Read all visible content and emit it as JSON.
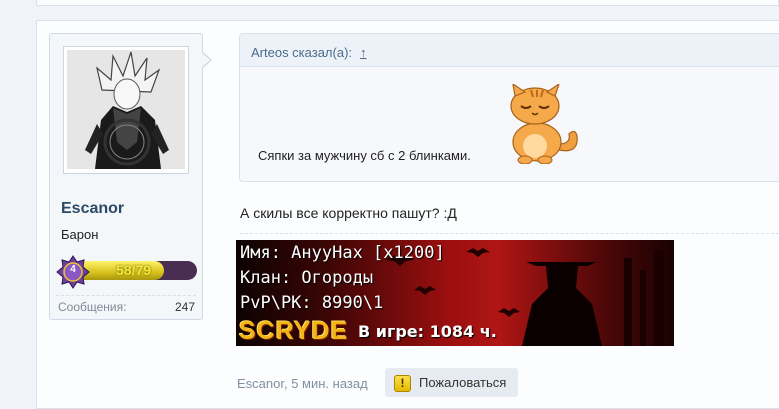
{
  "user": {
    "name": "Escanor",
    "title": "Барон",
    "level": "4",
    "xp_text": "58/79",
    "xp_fraction": 0.734,
    "messages_label": "Сообщения:",
    "messages_count": "247"
  },
  "quote": {
    "author": "Arteos сказал(а):",
    "link_glyph": "↑",
    "text": "Сяпки за мужчину сб с 2 блинками."
  },
  "post": {
    "text": "А скилы все корректно пашут? :Д"
  },
  "signature": {
    "name_line": "Имя: АнууНах [x1200]",
    "clan_line": "Клан: Огороды",
    "pvp_line": "PvP\\PK: 8990\\1",
    "logo": "SCRYDE",
    "ingame": "В игре: 1084 ч."
  },
  "meta": {
    "author_time": "Escanor, 5 мин. назад",
    "report_label": "Пожаловаться"
  },
  "colors": {
    "username": "#2b4a66",
    "link": "#4a6b8a",
    "xp_text": "#f2e93a",
    "logo": "#f3b418"
  }
}
